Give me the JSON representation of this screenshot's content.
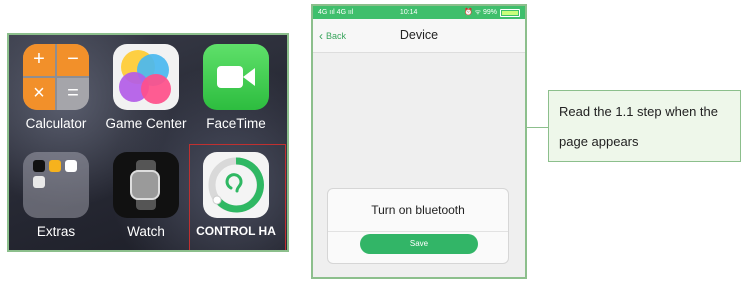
{
  "home_screen": {
    "apps": [
      {
        "label": "Calculator"
      },
      {
        "label": "Game Center"
      },
      {
        "label": "FaceTime"
      },
      {
        "label": "Extras"
      },
      {
        "label": "Watch"
      },
      {
        "label": "CONTROL HA"
      }
    ],
    "calculator_keys": [
      "+",
      "−",
      "×",
      "="
    ]
  },
  "phone": {
    "status": {
      "carrier": "4G ııl 4G ııl",
      "time": "10:14",
      "right": "⏰ ᯤ 99%"
    },
    "nav": {
      "back_label": "Back",
      "title": "Device"
    },
    "dialog": {
      "message": "Turn on bluetooth",
      "button_label": "Save"
    }
  },
  "callout": {
    "text": "Read the 1.1 step when the page appears"
  },
  "colors": {
    "accent_green": "#32b567",
    "frame_green": "#8cbf8c",
    "highlight_red": "#c03030"
  }
}
